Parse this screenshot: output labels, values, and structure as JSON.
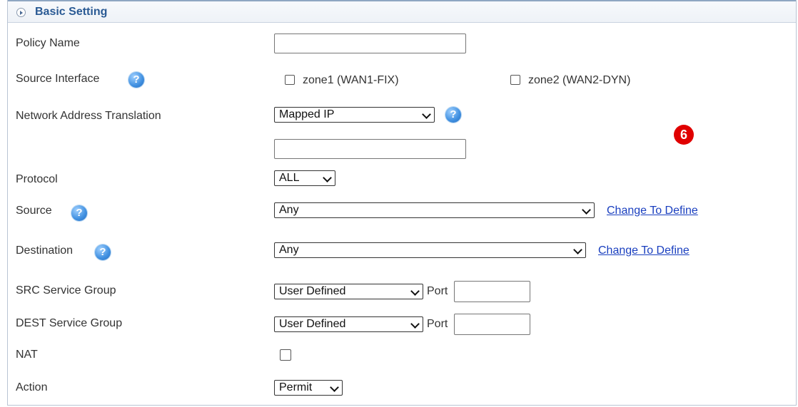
{
  "section": {
    "title": "Basic Setting"
  },
  "fields": {
    "policy_name": {
      "label": "Policy Name",
      "value": ""
    },
    "source_interface": {
      "label": "Source Interface",
      "options": [
        {
          "label": "zone1 (WAN1-FIX)",
          "checked": false
        },
        {
          "label": "zone2 (WAN2-DYN)",
          "checked": false
        }
      ]
    },
    "nat_mode": {
      "label": "Network Address Translation",
      "selected": "Mapped IP",
      "ip_value": ""
    },
    "protocol": {
      "label": "Protocol",
      "selected": "ALL"
    },
    "source": {
      "label": "Source",
      "selected": "Any",
      "link": "Change To Define"
    },
    "destination": {
      "label": "Destination",
      "selected": "Any",
      "link": "Change To Define"
    },
    "src_service_group": {
      "label": "SRC Service Group",
      "selected": "User Defined",
      "port_label": "Port",
      "port_value": ""
    },
    "dest_service_group": {
      "label": "DEST Service Group",
      "selected": "User Defined",
      "port_label": "Port",
      "port_value": ""
    },
    "nat": {
      "label": "NAT",
      "checked": false
    },
    "action": {
      "label": "Action",
      "selected": "Permit"
    }
  },
  "annotation": {
    "badge": "6"
  },
  "icons": {
    "help": "help-icon",
    "expand": "arrow-right-circle-icon"
  },
  "colors": {
    "title": "#2a5a94",
    "link": "#1a3fbf",
    "badge": "#e00000",
    "help": "#3f8fe0"
  }
}
